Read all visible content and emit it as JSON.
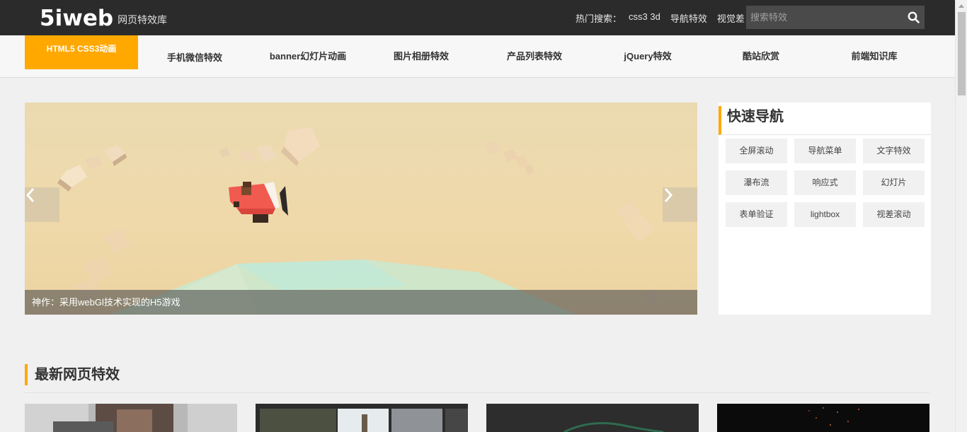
{
  "header": {
    "logo": "5iweb",
    "logo_sub": "网页特效库",
    "hot_label": "热门搜索：",
    "hot_links": [
      "css3 3d",
      "导航特效",
      "视觉差"
    ],
    "search_placeholder": "搜索特效"
  },
  "nav": {
    "items": [
      "HTML5 CSS3动画",
      "手机微信特效",
      "banner幻灯片动画",
      "图片相册特效",
      "产品列表特效",
      "jQuery特效",
      "酷站欣赏",
      "前端知识库"
    ],
    "active_index": 0
  },
  "banner": {
    "caption": "神作：采用webGl技术实现的H5游戏"
  },
  "quick_nav": {
    "title": "快速导航",
    "tags": [
      "全屏滚动",
      "导航菜单",
      "文字特效",
      "瀑布流",
      "响应式",
      "幻灯片",
      "表单验证",
      "lightbox",
      "视差滚动"
    ]
  },
  "latest": {
    "title": "最新网页特效"
  },
  "colors": {
    "accent": "#ffa800",
    "topbar": "#2b2b2b"
  }
}
